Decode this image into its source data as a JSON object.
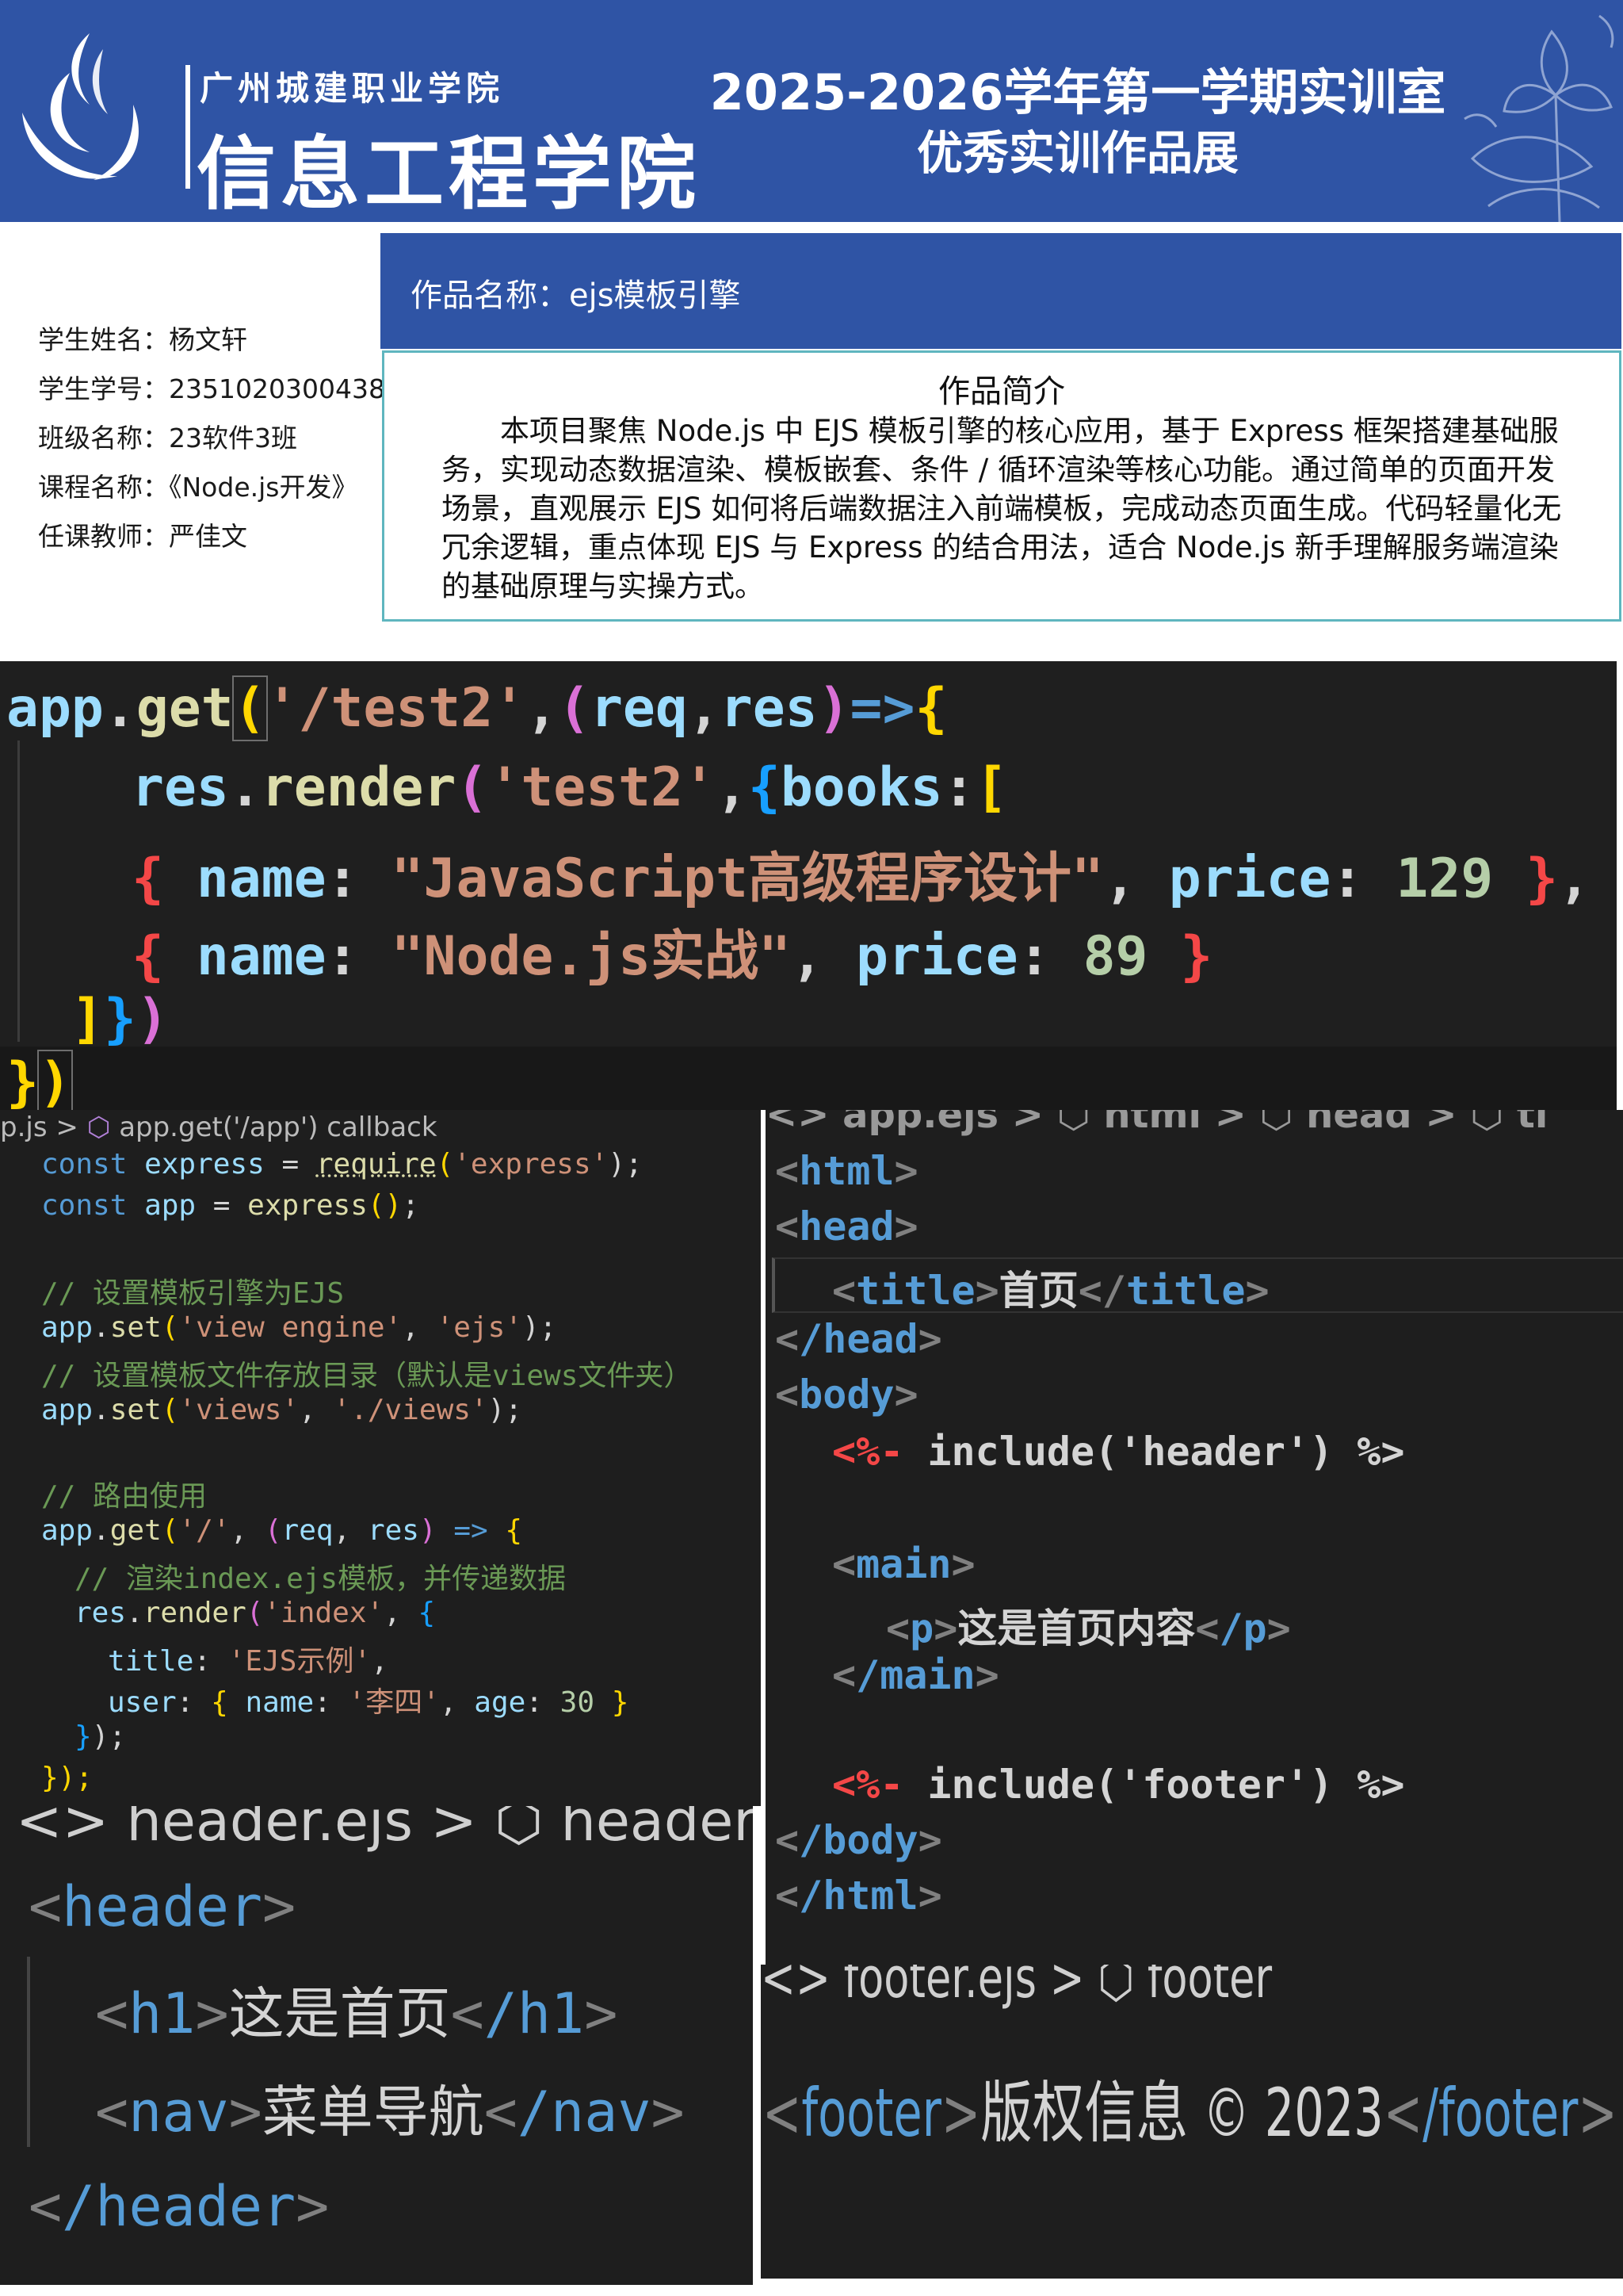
{
  "header": {
    "school_small": "广州城建职业学院",
    "school_big": "信息工程学院",
    "title_line1": "2025-2026学年第一学期实训室",
    "title_line2": "优秀实训作品展"
  },
  "student": {
    "name": "学生姓名：杨文轩",
    "id": "学生学号：2351020300438",
    "class": "班级名称：23软件3班",
    "course": "课程名称：《Node.js开发》",
    "teacher": "任课教师：严佳文"
  },
  "work": {
    "name": "作品名称：ejs模板引擎",
    "intro_heading": "作品简介",
    "intro_text": "本项目聚焦 Node.js 中 EJS 模板引擎的核心应用，基于 Express 框架搭建基础服务，实现动态数据渲染、模板嵌套、条件 / 循环渲染等核心功能。通过简单的页面开发场景，直观展示 EJS 如何将后端数据注入前端模板，完成动态页面生成。代码轻量化无冗余逻辑，重点体现 EJS 与 Express 的结合用法，适合 Node.js 新手理解服务端渲染的基础原理与实操方式。"
  },
  "code1": {
    "l1a": "app",
    "l1b": ".",
    "l1c": "get",
    "l1d": "(",
    "l1e": "'/test2'",
    "l1f": ",",
    "l1g": "(",
    "l1h": "req",
    "l1i": ",",
    "l1j": "res",
    "l1k": ")",
    "l1l": "=>",
    "l1m": "{",
    "l2a": "res",
    "l2b": ".",
    "l2c": "render",
    "l2d": "(",
    "l2e": "'test2'",
    "l2f": ",",
    "l2g": "{",
    "l2h": "books",
    "l2i": ":",
    "l2j": "[",
    "l3a": "{",
    "l3b": "name",
    "l3c": ":",
    "l3d": "\"JavaScript高级程序设计\"",
    "l3e": ",",
    "l3f": "price",
    "l3g": ":",
    "l3h": "129",
    "l3i": "}",
    "l3j": ",",
    "l4a": "{",
    "l4b": "name",
    "l4c": ":",
    "l4d": "\"Node.js实战\"",
    "l4e": ",",
    "l4f": "price",
    "l4g": ":",
    "l4h": "89",
    "l4i": "}",
    "l5a": "]",
    "l5b": "}",
    "l5c": ")",
    "l6a": "}",
    "l6b": ")"
  },
  "code2": {
    "crumb_file": "p.js",
    "crumb_sep": ">",
    "crumb_fn": "app.get('/app') callback",
    "l1a": "const",
    "l1b": "express",
    "l1c": "=",
    "l1d": "require",
    "l1e": "(",
    "l1f": "'express'",
    "l1g": ");",
    "l2a": "const",
    "l2b": "app",
    "l2c": "=",
    "l2d": "express",
    "l2e": "()",
    "l2f": ";",
    "c1": "// 设置模板引擎为EJS",
    "l3a": "app",
    "l3b": ".",
    "l3c": "set",
    "l3d": "(",
    "l3e": "'view engine'",
    "l3f": ",",
    "l3g": "'ejs'",
    "l3h": ");",
    "c2": "// 设置模板文件存放目录（默认是views文件夹）",
    "l4a": "app",
    "l4b": ".",
    "l4c": "set",
    "l4d": "(",
    "l4e": "'views'",
    "l4f": ",",
    "l4g": "'./views'",
    "l4h": ");",
    "c3": "// 路由使用",
    "l5a": "app",
    "l5b": ".",
    "l5c": "get",
    "l5d": "(",
    "l5e": "'/'",
    "l5f": ",",
    "l5g": "(",
    "l5h": "req",
    "l5i": ",",
    "l5j": "res",
    "l5k": ")",
    "l5l": "=>",
    "l5m": "{",
    "c4": "// 渲染index.ejs模板，并传递数据",
    "l6a": "res",
    "l6b": ".",
    "l6c": "render",
    "l6d": "(",
    "l6e": "'index'",
    "l6f": ",",
    "l6g": "{",
    "l7a": "title",
    "l7b": ":",
    "l7c": "'EJS示例'",
    "l7d": ",",
    "l8a": "user",
    "l8b": ":",
    "l8c": "{",
    "l8d": "name",
    "l8e": ":",
    "l8f": "'李四'",
    "l8g": ",",
    "l8h": "age",
    "l8i": ":",
    "l8j": "30",
    "l8k": "}",
    "l9a": "}",
    "l9b": ");",
    "l10a": "});"
  },
  "code3": {
    "crumb": "<> app.ejs > ⬡ html > ⬡ head > ⬡ ti",
    "l1": "html",
    "l2": "head",
    "l3": "title",
    "l3t": "首页",
    "l4": "/head",
    "l5": "body",
    "l6a": "<%-",
    "l6b": "include",
    "l6c": "('header')",
    "l6d": "%>",
    "l7": "main",
    "l8": "p",
    "l8t": "这是首页内容",
    "l8c": "/p",
    "l9": "/main",
    "l10a": "<%-",
    "l10b": "include",
    "l10c": "('footer')",
    "l10d": "%>",
    "l11": "/body",
    "l12": "/html"
  },
  "code4": {
    "crumb": "<> header.ejs > ⬡ header >",
    "l1": "header",
    "l2a": "h1",
    "l2t": "这是首页",
    "l2c": "/h1",
    "l3a": "nav",
    "l3t": "菜单导航",
    "l3c": "/nav",
    "l4": "/header"
  },
  "code5": {
    "crumb": "<> footer.ejs > ⬡ footer",
    "l1a": "footer",
    "l1t": "版权信息 © 2023",
    "l1c": "/footer"
  }
}
